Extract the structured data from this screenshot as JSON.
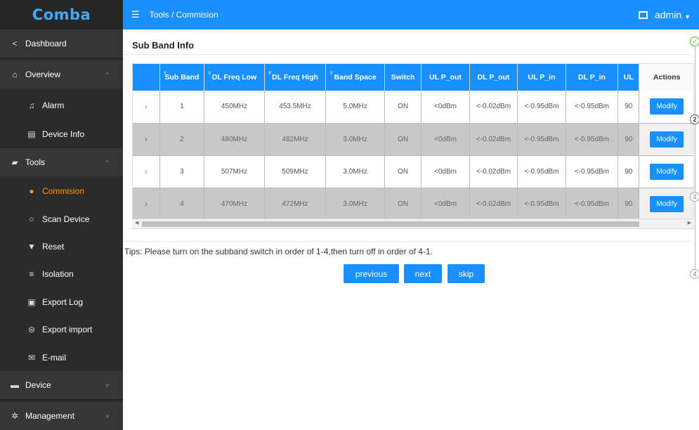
{
  "logo": "Comba",
  "header": {
    "breadcrumb": "Tools  /  Commision",
    "user": "admin"
  },
  "sidebar": {
    "items": [
      {
        "label": "Dashboard",
        "icon": "share-icon"
      },
      {
        "label": "Overview",
        "icon": "home-icon"
      },
      {
        "label": "Alarm",
        "icon": "bell-icon"
      },
      {
        "label": "Device Info",
        "icon": "document-icon"
      },
      {
        "label": "Tools",
        "icon": "briefcase-icon"
      },
      {
        "label": "Commision",
        "icon": "info-icon"
      },
      {
        "label": "Scan Device",
        "icon": "search-icon"
      },
      {
        "label": "Reset",
        "icon": "reset-icon"
      },
      {
        "label": "Isolation",
        "icon": "sliders-icon"
      },
      {
        "label": "Export Log",
        "icon": "clipboard-icon"
      },
      {
        "label": "Export import",
        "icon": "database-icon"
      },
      {
        "label": "E-mail",
        "icon": "mail-icon"
      },
      {
        "label": "Device",
        "icon": "monitor-icon"
      },
      {
        "label": "Management",
        "icon": "gear-icon"
      }
    ]
  },
  "main": {
    "section_title": "Sub Band Info",
    "table": {
      "columns": [
        "Sub Band",
        "DL Freq Low",
        "DL Freq High",
        "Band Space",
        "Switch",
        "UL P_out",
        "DL P_out",
        "UL P_in",
        "DL P_in",
        "UL",
        "Actions"
      ],
      "rows": [
        {
          "sub_band": "1",
          "dl_freq_low": "450MHz",
          "dl_freq_high": "453.5MHz",
          "band_space": "5.0MHz",
          "switch": "ON",
          "ul_p_out": "<0dBm",
          "dl_p_out": "<-0.02dBm",
          "ul_p_in": "<-0.95dBm",
          "dl_p_in": "<-0.95dBm",
          "ul": "90",
          "action": "Modify"
        },
        {
          "sub_band": "2",
          "dl_freq_low": "480MHz",
          "dl_freq_high": "482MHz",
          "band_space": "3.0MHz",
          "switch": "ON",
          "ul_p_out": "<0dBm",
          "dl_p_out": "<-0.02dBm",
          "ul_p_in": "<-0.95dBm",
          "dl_p_in": "<-0.95dBm",
          "ul": "90",
          "action": "Modify"
        },
        {
          "sub_band": "3",
          "dl_freq_low": "507MHz",
          "dl_freq_high": "509MHz",
          "band_space": "3.0MHz",
          "switch": "ON",
          "ul_p_out": "<0dBm",
          "dl_p_out": "<-0.02dBm",
          "ul_p_in": "<-0.95dBm",
          "dl_p_in": "<-0.95dBm",
          "ul": "90",
          "action": "Modify"
        },
        {
          "sub_band": "4",
          "dl_freq_low": "470MHz",
          "dl_freq_high": "472MHz",
          "band_space": "3.0MHz",
          "switch": "ON",
          "ul_p_out": "<0dBm",
          "dl_p_out": "<-0.02dBm",
          "ul_p_in": "<-0.95dBm",
          "dl_p_in": "<-0.95dBm",
          "ul": "90",
          "action": "Modify"
        }
      ]
    },
    "tips": "Tips: Please turn on the subband switch in order of 1-4,then turn off in order of 4-1.",
    "buttons": {
      "previous": "previous",
      "next": "next",
      "skip": "skip"
    }
  },
  "steps": [
    {
      "label": "✓",
      "state": "done"
    },
    {
      "label": "2",
      "state": "current"
    },
    {
      "label": "3",
      "state": "pending"
    },
    {
      "label": "4",
      "state": "pending"
    }
  ],
  "colors": {
    "accent": "#1890ff",
    "sidebar": "#2b2b2b",
    "active": "#ff9500"
  }
}
